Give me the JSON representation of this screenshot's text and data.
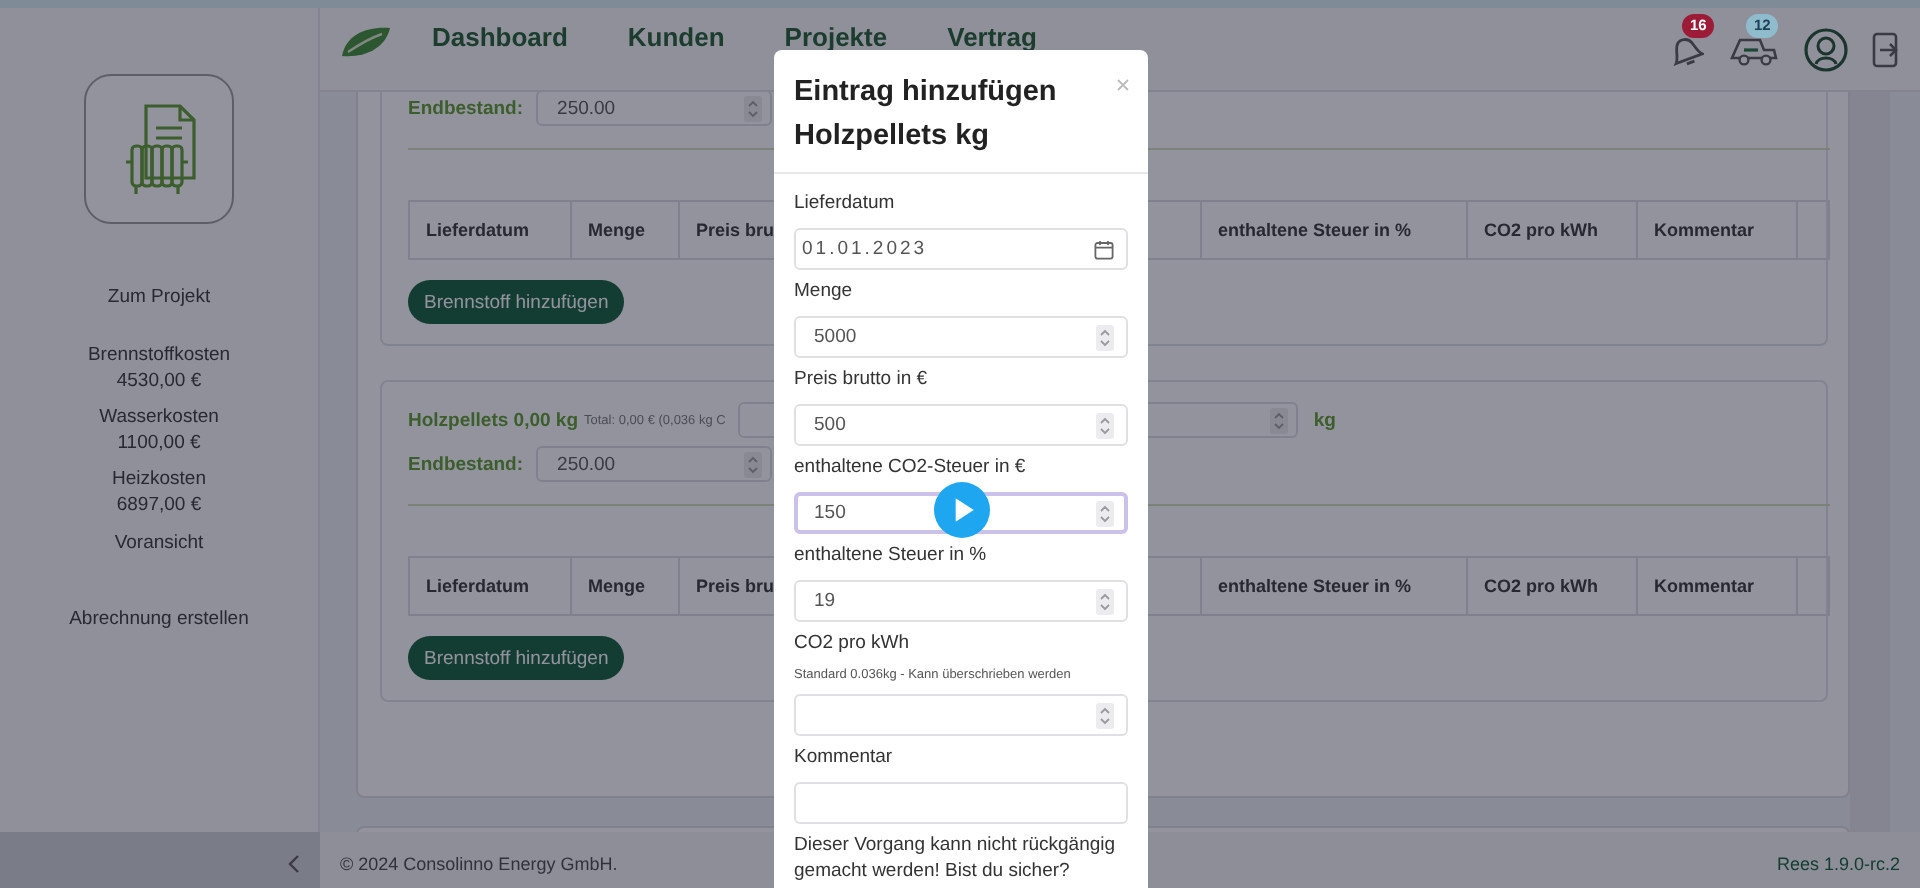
{
  "sidebar": {
    "items": [
      {
        "kind": "link",
        "label": "Zum Projekt"
      },
      {
        "kind": "cost",
        "label": "Brennstoffkosten",
        "value": "4530,00 €"
      },
      {
        "kind": "cost",
        "label": "Wasserkosten",
        "value": "1100,00 €"
      },
      {
        "kind": "cost",
        "label": "Heizkosten",
        "value": "6897,00 €"
      },
      {
        "kind": "link",
        "label": "Voransicht"
      },
      {
        "kind": "action",
        "label": "Abrechnung erstellen"
      }
    ]
  },
  "nav": {
    "items": [
      "Dashboard",
      "Kunden",
      "Projekte",
      "Vertrag"
    ],
    "icons": [
      {
        "kind": "bell",
        "badge": "16",
        "color": "#9c1c37"
      },
      {
        "kind": "truck",
        "badge": "12",
        "color": "#8fbccc"
      },
      {
        "kind": "user"
      },
      {
        "kind": "logout"
      }
    ]
  },
  "sections": [
    {
      "endbestand_label": "Endbestand:",
      "endbestand": "250.00",
      "columns": [
        "Lieferdatum",
        "Menge",
        "Preis bru",
        "enthaltene Steuer in %",
        "CO2 pro kWh",
        "Kommentar"
      ],
      "button": "Brennstoff hinzufügen"
    },
    {
      "title": "Holzpellets 0,00 kg",
      "subtitle": "Total: 0,00 € (0,036 kg C",
      "unit": "kg",
      "endbestand_label": "Endbestand:",
      "endbestand": "250.00",
      "columns": [
        "Lieferdatum",
        "Menge",
        "Preis bru",
        "enthaltene Steuer in %",
        "CO2 pro kWh",
        "Kommentar"
      ],
      "button": "Brennstoff hinzufügen"
    }
  ],
  "footer": {
    "copyright": "© 2024 Consolinno Energy GmbH.",
    "version": "Rees 1.9.0-rc.2"
  },
  "modal": {
    "title": [
      "Eintrag hinzufügen",
      "Holzpellets kg"
    ],
    "fields": [
      {
        "kind": "date",
        "label": "Lieferdatum",
        "value": "01.01.2023",
        "focused": false
      },
      {
        "kind": "number",
        "label": "Menge",
        "value": "5000",
        "focused": false
      },
      {
        "kind": "number",
        "label": "Preis brutto in €",
        "value": "500",
        "focused": false
      },
      {
        "kind": "number",
        "label": "enthaltene CO2-Steuer in €",
        "value": "150",
        "focused": true
      },
      {
        "kind": "number",
        "label": "enthaltene Steuer in %",
        "value": "19",
        "focused": false
      },
      {
        "kind": "number",
        "label": "CO2 pro kWh",
        "hint": "Standard 0.036kg - Kann überschrieben werden",
        "focused": false
      },
      {
        "kind": "text",
        "label": "Kommentar",
        "focused": false
      }
    ],
    "warning": "Dieser Vorgang kann nicht rückgängig gemacht werden! Bist du sicher?"
  }
}
